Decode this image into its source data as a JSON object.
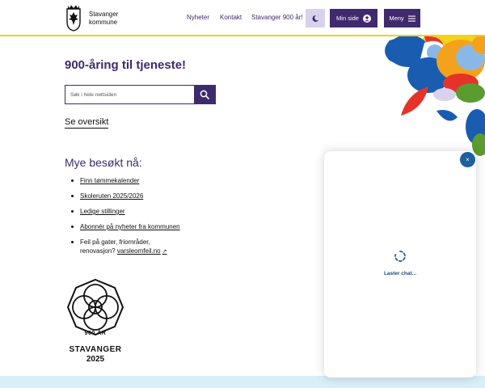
{
  "header": {
    "brand_line1": "Stavanger",
    "brand_line2": "kommune",
    "nav": [
      "Nyheter",
      "Kontakt",
      "Stavanger 900 år!"
    ],
    "min_side_label": "Min side",
    "menu_label": "Meny",
    "accent_color": "#3f2a6e",
    "border_color": "#f2d21a"
  },
  "main": {
    "title": "900-åring til tjeneste!",
    "search_placeholder": "Søk i hele nettsiden",
    "overview_link": "Se oversikt",
    "popular_title": "Mye besøkt nå:",
    "popular_items": [
      "Finn tømmekalender",
      "Skoleruten 2025/2026",
      "Ledige stillinger",
      "Abonnér på nyheter fra kommunen"
    ],
    "report_text_line1": "Feil på gater, friområder,",
    "report_text_line2": "renovasjon?",
    "report_link": "varsleomfeil.no",
    "emblem_year": "900 ÅR",
    "emblem_name": "STAVANGER",
    "emblem_year2": "2025"
  },
  "chat": {
    "status": "Laster chat...",
    "close_label": "×"
  },
  "icons": {
    "dark_mode": "moon-icon",
    "account": "user-circle-icon",
    "menu": "hamburger-icon",
    "search": "search-icon",
    "external": "external-link-icon",
    "spinner": "spinner-icon",
    "close": "close-icon"
  }
}
